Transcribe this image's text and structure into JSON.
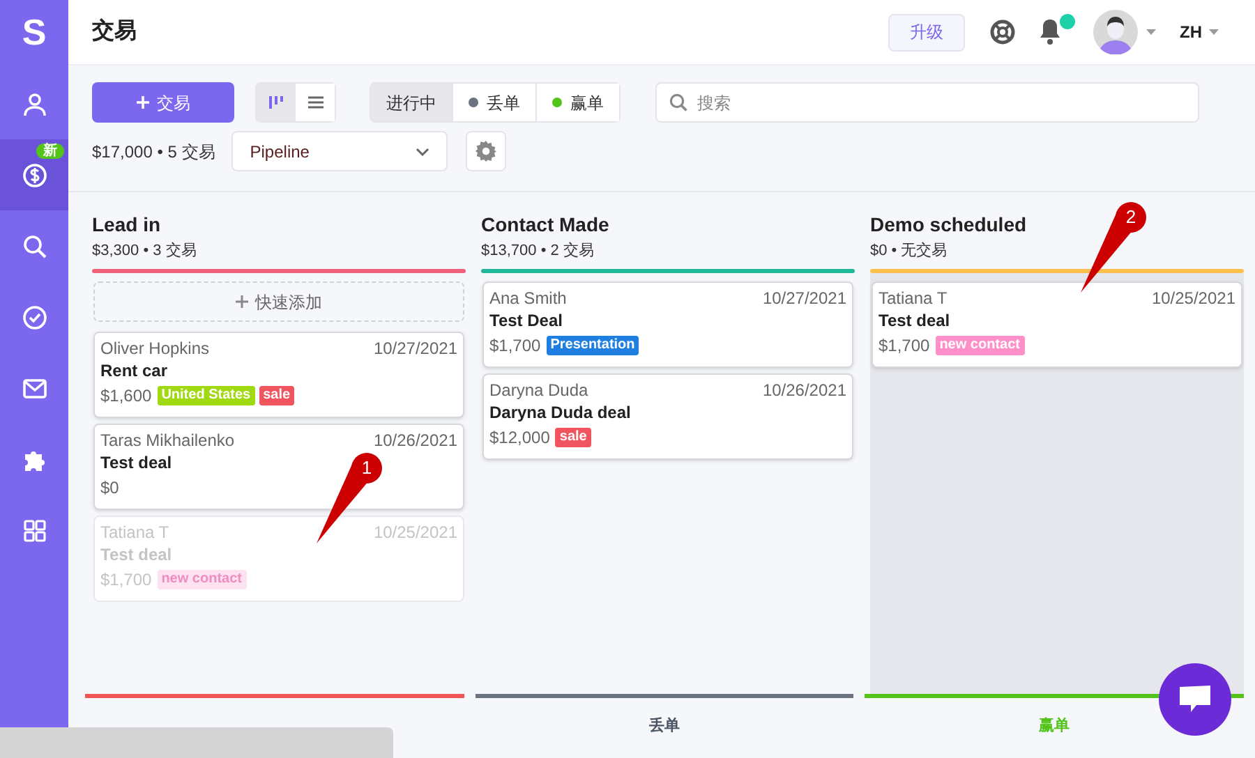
{
  "logo": "S",
  "sidebar": {
    "items": [
      {
        "kind": "user",
        "selected": false
      },
      {
        "kind": "deals",
        "selected": true,
        "badge": "新"
      },
      {
        "kind": "search",
        "selected": false
      },
      {
        "kind": "tasks",
        "selected": false
      },
      {
        "kind": "mail",
        "selected": false
      },
      {
        "kind": "plugins",
        "selected": false
      },
      {
        "kind": "apps",
        "selected": false
      }
    ]
  },
  "header": {
    "title": "交易",
    "upgrade": "升级",
    "notification_dot": true,
    "language": "ZH"
  },
  "toolbar": {
    "add_button": "交易",
    "views": [
      {
        "kind": "board",
        "selected": true
      },
      {
        "kind": "list",
        "selected": false
      }
    ],
    "filters": [
      {
        "label": "进行中",
        "selected": true
      },
      {
        "label": "丢单",
        "selected": false,
        "color": "#6b7280"
      },
      {
        "label": "赢单",
        "selected": false,
        "color": "#52c41a"
      }
    ],
    "search": {
      "placeholder": "搜索"
    },
    "summary": "$17,000 • 5 交易",
    "pipeline": "Pipeline"
  },
  "columns": [
    {
      "title": "Lead in",
      "summary": "$3,300 • 3 交易",
      "color": "#f0627b",
      "highlighted": false,
      "quick_add": "快速添加",
      "cards": [
        {
          "name": "Oliver Hopkins",
          "date": "10/27/2021",
          "title": "Rent car",
          "amount": "$1,600",
          "ghost": false,
          "tags": [
            {
              "label": "United States",
              "color": "#a0d911"
            },
            {
              "label": "sale",
              "color": "#f0545f"
            }
          ]
        },
        {
          "name": "Taras Mikhailenko",
          "date": "10/26/2021",
          "title": "Test deal",
          "amount": "$0",
          "ghost": false
        },
        {
          "name": "Tatiana T",
          "date": "10/25/2021",
          "title": "Test deal",
          "amount": "$1,700",
          "ghost": true,
          "tags": [
            {
              "label": "new contact",
              "color": "#fde2f1"
            }
          ]
        }
      ]
    },
    {
      "title": "Contact Made",
      "summary": "$13,700 • 2 交易",
      "color": "#1fb89a",
      "highlighted": false,
      "cards": [
        {
          "name": "Ana Smith",
          "date": "10/27/2021",
          "title": "Test Deal",
          "amount": "$1,700",
          "ghost": false,
          "tags": [
            {
              "label": "Presentation",
              "color": "#1e7fe0"
            }
          ]
        },
        {
          "name": "Daryna Duda",
          "date": "10/26/2021",
          "title": "Daryna Duda deal",
          "amount": "$12,000",
          "ghost": false,
          "tags": [
            {
              "label": "sale",
              "color": "#f0545f"
            }
          ]
        }
      ]
    },
    {
      "title": "Demo scheduled",
      "summary": "$0 • 无交易",
      "color": "#fbbf4e",
      "highlighted": true,
      "cards": [
        {
          "name": "Tatiana T",
          "date": "10/25/2021",
          "title": "Test deal",
          "amount": "$1,700",
          "ghost": false,
          "tags": [
            {
              "label": "new contact",
              "color": "#ff8fc8"
            }
          ]
        }
      ]
    }
  ],
  "drop_zones": [
    {
      "color": "#f05454"
    },
    {
      "label": "丢单",
      "color": "#6b7280"
    },
    {
      "label": "赢单",
      "color": "#52c41a"
    }
  ],
  "annotations": [
    {
      "label": "1"
    },
    {
      "label": "2"
    }
  ]
}
